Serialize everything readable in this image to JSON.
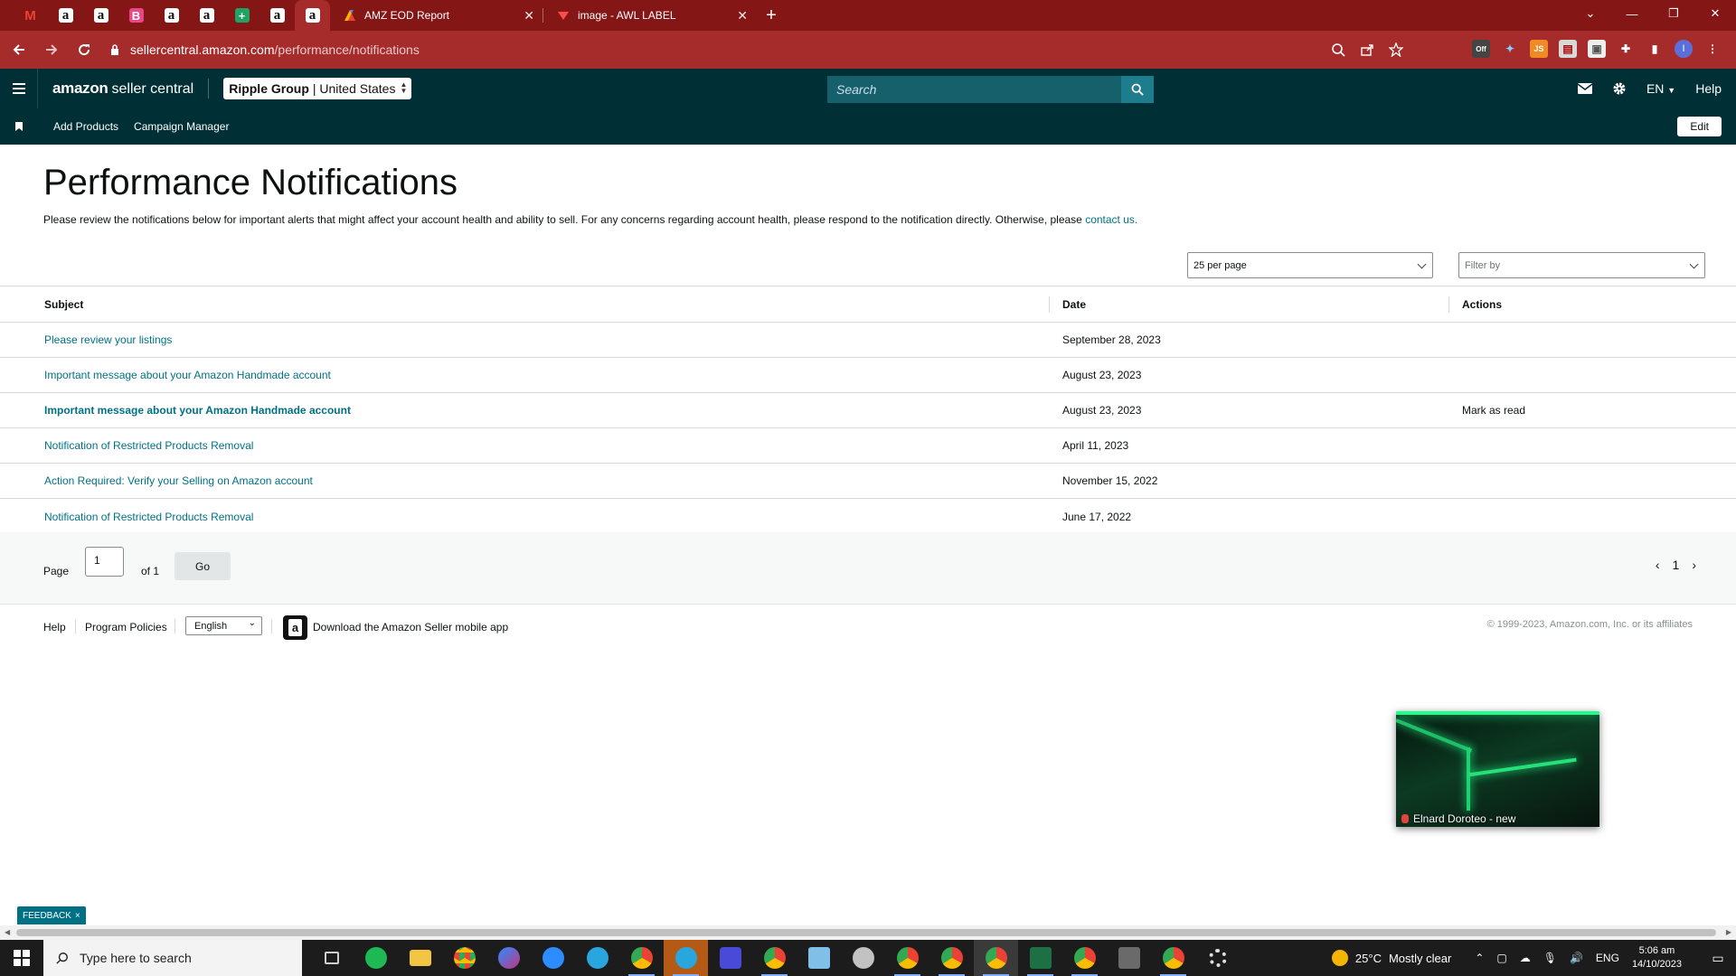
{
  "browser": {
    "pinned_tabs": [
      {
        "icon": "gmail-icon",
        "glyph": "M"
      },
      {
        "icon": "amazon-icon",
        "glyph": "a"
      },
      {
        "icon": "amazon-icon",
        "glyph": "a"
      },
      {
        "icon": "b-icon",
        "glyph": "B"
      },
      {
        "icon": "amazon-icon",
        "glyph": "a"
      },
      {
        "icon": "amazon-icon",
        "glyph": "a"
      },
      {
        "icon": "sheets-icon",
        "glyph": "+"
      },
      {
        "icon": "amazon-icon",
        "glyph": "a"
      },
      {
        "icon": "amazon-icon",
        "glyph": "a"
      }
    ],
    "tabs": [
      {
        "title": "AMZ EOD Report",
        "close": "✕"
      },
      {
        "title": "image - AWL LABEL",
        "close": "✕"
      }
    ],
    "new_tab": "+",
    "url_domain": "sellercentral.amazon.com",
    "url_path": "/performance/notifications",
    "window_controls": [
      "⌄",
      "—",
      "❐",
      "✕"
    ],
    "extensions": [
      "Off",
      "✦",
      "JS",
      "▤",
      "▣",
      "✚",
      "▮",
      "I",
      "⋮"
    ]
  },
  "header": {
    "logo_main": "amazon",
    "logo_sub": "seller central",
    "account_name": "Ripple Group",
    "account_region": "| United States",
    "search_placeholder": "Search",
    "lang": "EN",
    "help": "Help"
  },
  "subnav": {
    "links": [
      "Add Products",
      "Campaign Manager"
    ],
    "edit": "Edit"
  },
  "page": {
    "title": "Performance Notifications",
    "intro": "Please review the notifications below for important alerts that might affect your account health and ability to sell. For any concerns regarding account health, please respond to the notification directly. Otherwise, please ",
    "intro_link": "contact us."
  },
  "controls": {
    "per_page": "25 per page",
    "filter": "Filter by"
  },
  "table": {
    "headers": {
      "subject": "Subject",
      "date": "Date",
      "actions": "Actions"
    },
    "rows": [
      {
        "subject": "Please review your listings",
        "date": "September 28, 2023",
        "action": "",
        "bold": false
      },
      {
        "subject": "Important message about your Amazon Handmade account",
        "date": "August 23, 2023",
        "action": "",
        "bold": false
      },
      {
        "subject": "Important message about your Amazon Handmade account",
        "date": "August 23, 2023",
        "action": "Mark as read",
        "bold": true
      },
      {
        "subject": "Notification of Restricted Products Removal",
        "date": "April 11, 2023",
        "action": "",
        "bold": false
      },
      {
        "subject": "Action Required: Verify your Selling on Amazon account",
        "date": "November 15, 2022",
        "action": "",
        "bold": false
      },
      {
        "subject": "Notification of Restricted Products Removal",
        "date": "June 17, 2022",
        "action": "",
        "bold": false
      }
    ]
  },
  "pager": {
    "page_label": "Page",
    "page_value": "1",
    "of_label": "of 1",
    "go": "Go",
    "current": "1"
  },
  "footer": {
    "help": "Help",
    "policies": "Program Policies",
    "language": "English",
    "download": "Download the Amazon Seller mobile app",
    "copyright": "© 1999-2023, Amazon.com, Inc. or its affiliates"
  },
  "video": {
    "caption": "Elnard Doroteo - new"
  },
  "feedback": {
    "label": "FEEDBACK",
    "close": "×"
  },
  "taskbar": {
    "search_placeholder": "Type here to search",
    "apps": [
      {
        "name": "task-view",
        "color": "#cfcfcf"
      },
      {
        "name": "spotify",
        "color": "#1db954"
      },
      {
        "name": "file-explorer",
        "color": "#f4c542"
      },
      {
        "name": "chrome",
        "color": "#e9b92b"
      },
      {
        "name": "messenger",
        "color": "#8b5cf6"
      },
      {
        "name": "zoom",
        "color": "#2d8cff"
      },
      {
        "name": "telegram",
        "color": "#2aa6df"
      },
      {
        "name": "chrome-profile",
        "color": "#d94b3f"
      },
      {
        "name": "telegram-active",
        "color": "#2aa6df"
      },
      {
        "name": "app-blue",
        "color": "#4a4ad8"
      },
      {
        "name": "chrome-profile-2",
        "color": "#d94b3f"
      },
      {
        "name": "notepad",
        "color": "#7fbfe8"
      },
      {
        "name": "app-photo",
        "color": "#c2c2c2"
      },
      {
        "name": "chrome-profile-3",
        "color": "#33a852"
      },
      {
        "name": "chrome-2",
        "color": "#e9b92b"
      },
      {
        "name": "chrome-3",
        "color": "#d94b3f"
      },
      {
        "name": "excel",
        "color": "#1d7044"
      },
      {
        "name": "chrome-4",
        "color": "#c94bd0"
      },
      {
        "name": "calculator",
        "color": "#6a6a6a"
      },
      {
        "name": "chrome-5",
        "color": "#2a9d5a"
      },
      {
        "name": "settings",
        "color": "#e0e0e0"
      }
    ],
    "weather_temp": "25°C",
    "weather_text": "Mostly clear",
    "lang": "ENG",
    "time": "5:06 am",
    "date": "14/10/2023"
  }
}
